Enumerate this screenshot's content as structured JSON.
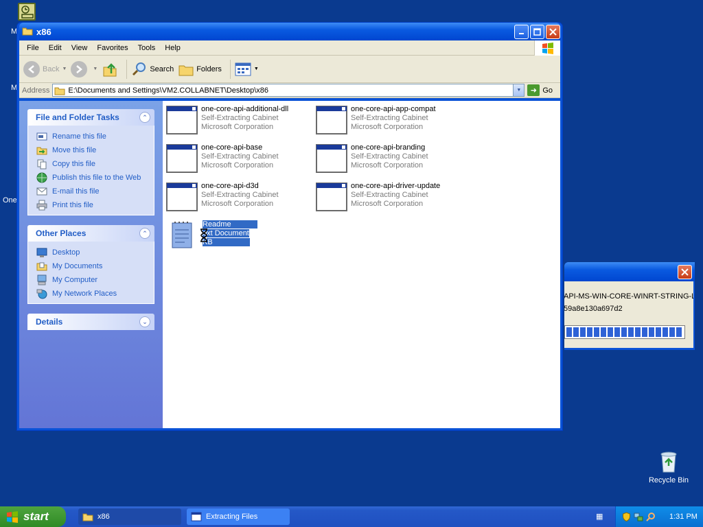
{
  "desktop": {
    "left_letters": [
      "M",
      "M",
      "One"
    ],
    "recycle_bin_label": "Recycle Bin"
  },
  "window": {
    "title": "x86",
    "menu": [
      "File",
      "Edit",
      "View",
      "Favorites",
      "Tools",
      "Help"
    ],
    "toolbar": {
      "back": "Back",
      "search": "Search",
      "folders": "Folders"
    },
    "address": {
      "label": "Address",
      "path": "E:\\Documents and Settings\\VM2.COLLABNET\\Desktop\\x86",
      "go": "Go"
    },
    "tasks_panel": {
      "title": "File and Folder Tasks",
      "items": [
        "Rename this file",
        "Move this file",
        "Copy this file",
        "Publish this file to the Web",
        "E-mail this file",
        "Print this file"
      ]
    },
    "places_panel": {
      "title": "Other Places",
      "items": [
        "Desktop",
        "My Documents",
        "My Computer",
        "My Network Places"
      ]
    },
    "details_panel": {
      "title": "Details"
    },
    "files": [
      {
        "name": "one-core-api-additional-dll",
        "type": "Self-Extracting Cabinet",
        "company": "Microsoft Corporation"
      },
      {
        "name": "one-core-api-app-compat",
        "type": "Self-Extracting Cabinet",
        "company": "Microsoft Corporation"
      },
      {
        "name": "one-core-api-base",
        "type": "Self-Extracting Cabinet",
        "company": "Microsoft Corporation"
      },
      {
        "name": "one-core-api-branding",
        "type": "Self-Extracting Cabinet",
        "company": "Microsoft Corporation"
      },
      {
        "name": "one-core-api-d3d",
        "type": "Self-Extracting Cabinet",
        "company": "Microsoft Corporation"
      },
      {
        "name": "one-core-api-driver-update",
        "type": "Self-Extracting Cabinet",
        "company": "Microsoft Corporation"
      },
      {
        "name": "Readme",
        "type": "ext Document",
        "company": "KB"
      }
    ]
  },
  "dialog": {
    "line1": "API-MS-WIN-CORE-WINRT-STRING-L",
    "line2": "59a8e130a697d2",
    "progress_segments": 17
  },
  "taskbar": {
    "start": "start",
    "tasks": [
      "x86",
      "Extracting Files"
    ],
    "clock": "1:31 PM"
  }
}
